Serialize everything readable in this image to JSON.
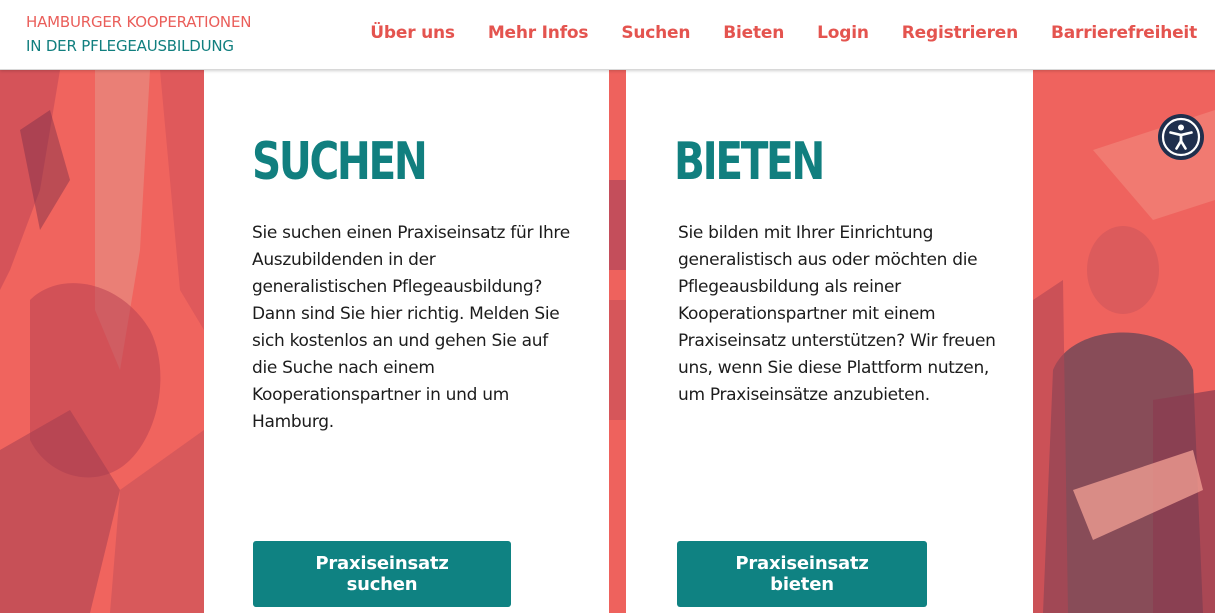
{
  "brand": {
    "line1": "HAMBURGER KOOPERATIONEN",
    "line2": "IN DER PFLEGEAUSBILDUNG"
  },
  "nav": {
    "items": [
      {
        "label": "Über uns"
      },
      {
        "label": "Mehr Infos"
      },
      {
        "label": "Suchen"
      },
      {
        "label": "Bieten"
      },
      {
        "label": "Login"
      },
      {
        "label": "Registrieren"
      },
      {
        "label": "Barrierefreiheit"
      }
    ]
  },
  "cards": [
    {
      "title": "SUCHEN",
      "text": "Sie suchen einen Praxiseinsatz für Ihre Auszubildenden in der generalistischen Pflegeausbildung? Dann sind Sie hier richtig. Melden Sie sich kostenlos an und gehen Sie auf die Suche nach einem Kooperationspartner in und um Hamburg.",
      "button": "Praxiseinsatz suchen"
    },
    {
      "title": "BIETEN",
      "text": "Sie bilden mit Ihrer Einrichtung generalistisch aus oder möchten die Pflegeausbildung als reiner Kooperationspartner mit einem Praxiseinsatz unterstützen? Wir freuen uns, wenn Sie diese Plattform nutzen, um Praxiseinsätze anzubieten.",
      "button": "Praxiseinsatz bieten"
    }
  ],
  "icons": {
    "accessibility": "accessibility-icon"
  },
  "colors": {
    "accent_red": "#e4544f",
    "accent_teal": "#117f7f",
    "photo_tint": "#f0645e",
    "button_bg": "#0f8282"
  }
}
